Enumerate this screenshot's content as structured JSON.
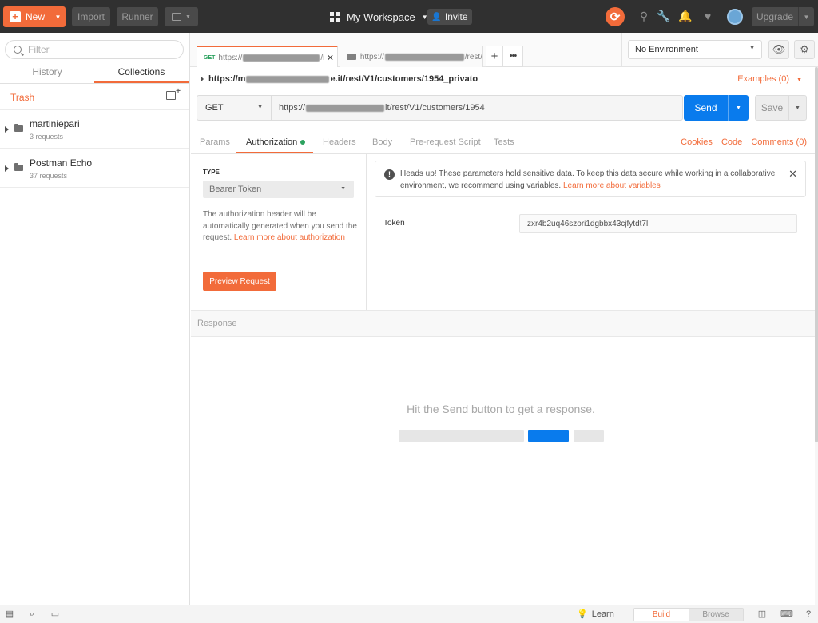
{
  "topbar": {
    "new_label": "New",
    "import_label": "Import",
    "runner_label": "Runner",
    "workspace_label": "My Workspace",
    "invite_label": "Invite",
    "upgrade_label": "Upgrade"
  },
  "sidebar": {
    "filter_placeholder": "Filter",
    "tabs": [
      "History",
      "Collections"
    ],
    "active_tab": "Collections",
    "trash_label": "Trash",
    "collections": [
      {
        "name": "martiniepari",
        "count": "3 requests"
      },
      {
        "name": "Postman Echo",
        "count": "37 requests"
      }
    ]
  },
  "request_tabs": [
    {
      "method": "GET",
      "url_prefix": "https://",
      "url_suffix": "/i"
    },
    {
      "url_prefix": "https://",
      "url_suffix": "/rest/"
    }
  ],
  "environment": {
    "selected": "No Environment"
  },
  "request": {
    "path_prefix": "https://m",
    "path_suffix": "e.it/rest/V1/customers/1954_privato",
    "examples_label": "Examples (0)",
    "method": "GET",
    "url_prefix": "https://",
    "url_suffix": "it/rest/V1/customers/1954",
    "send_label": "Send",
    "save_label": "Save"
  },
  "subtabs": {
    "items": [
      "Params",
      "Authorization",
      "Headers",
      "Body",
      "Pre-request Script",
      "Tests"
    ],
    "active": "Authorization",
    "right_links": [
      "Cookies",
      "Code",
      "Comments (0)"
    ]
  },
  "auth": {
    "type_label": "TYPE",
    "type_value": "Bearer Token",
    "description": "The authorization header will be automatically generated when you send the request.",
    "description_link": "Learn more about authorization",
    "preview_label": "Preview Request",
    "heads_up_text": "Heads up! These parameters hold sensitive data. To keep this data secure while working in a collaborative environment, we recommend using variables.",
    "heads_up_link": "Learn more about variables",
    "token_label": "Token",
    "token_value": "zxr4b2uq46szori1dgbbx43cjfytdt7l"
  },
  "response": {
    "label": "Response",
    "empty_message": "Hit the Send button to get a response."
  },
  "bottombar": {
    "learn_label": "Learn",
    "build_label": "Build",
    "browse_label": "Browse"
  },
  "colors": {
    "accent": "#f26b3a",
    "send_blue": "#097bed",
    "topbar_bg": "#303030",
    "success_green": "#2ca25f"
  }
}
